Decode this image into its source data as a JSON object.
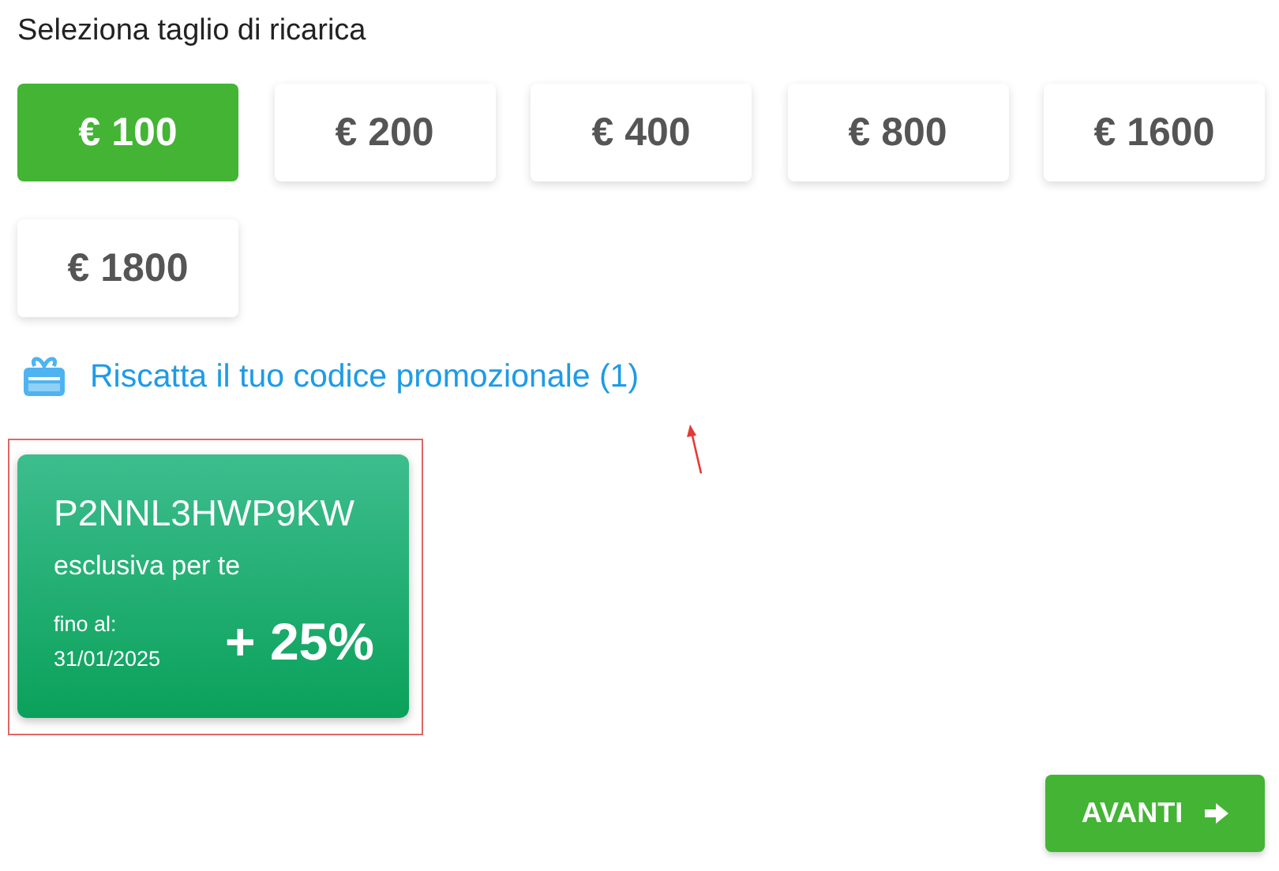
{
  "heading": "Seleziona taglio di ricarica",
  "amounts": [
    {
      "label": "€ 100",
      "selected": true
    },
    {
      "label": "€ 200",
      "selected": false
    },
    {
      "label": "€ 400",
      "selected": false
    },
    {
      "label": "€ 800",
      "selected": false
    },
    {
      "label": "€ 1600",
      "selected": false
    },
    {
      "label": "€ 1800",
      "selected": false
    }
  ],
  "promo_link": "Riscatta il tuo codice promozionale (1)",
  "promo_card": {
    "code": "P2NNL3HWP9KW",
    "subtitle": "esclusiva per te",
    "valid_label": "fino al:",
    "valid_date": "31/01/2025",
    "bonus": "+ 25%",
    "highlighted": true
  },
  "next_button": "AVANTI"
}
